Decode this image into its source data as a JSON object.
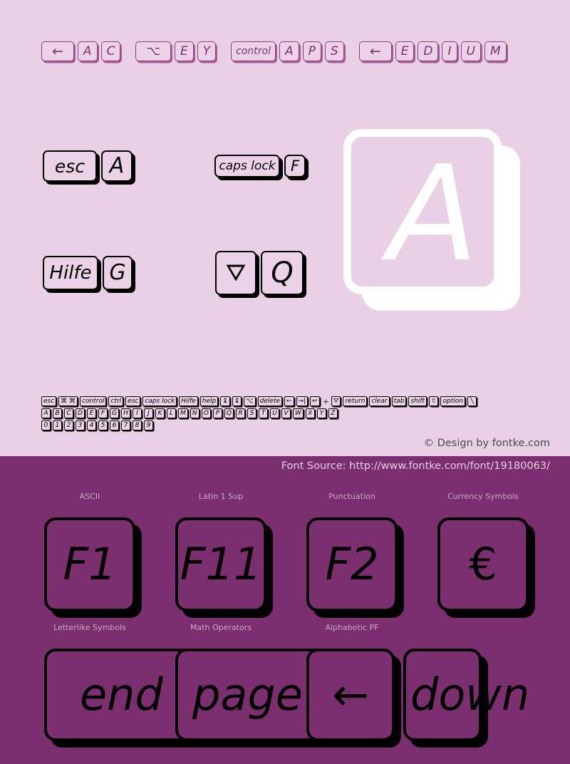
{
  "page": {
    "background_light": "#ead0e4",
    "background_dark": "#7b2f6e",
    "accent_outline": "#000000",
    "title_key_color": "#7d2f70"
  },
  "title_row": {
    "groups": [
      {
        "keys": [
          {
            "label": "←",
            "style": "arrow"
          },
          {
            "label": "A",
            "style": "letter"
          },
          {
            "label": "C",
            "style": "letter"
          }
        ]
      },
      {
        "keys": [
          {
            "label": "⌥",
            "style": "opt"
          },
          {
            "label": "E",
            "style": "letter"
          },
          {
            "label": "Y",
            "style": "letter"
          }
        ]
      },
      {
        "keys": [
          {
            "label": "control",
            "style": "word"
          },
          {
            "label": "A",
            "style": "letter"
          },
          {
            "label": "P",
            "style": "letter"
          },
          {
            "label": "S",
            "style": "letter"
          }
        ]
      },
      {
        "keys": [
          {
            "label": "←",
            "style": "arrow"
          },
          {
            "label": "E",
            "style": "letter"
          },
          {
            "label": "D",
            "style": "letter"
          },
          {
            "label": "I",
            "style": "letter"
          },
          {
            "label": "U",
            "style": "letter"
          },
          {
            "label": "M",
            "style": "letter"
          }
        ]
      }
    ]
  },
  "samples": {
    "esc": "esc",
    "a_small": "A",
    "caps_lock": "caps lock",
    "f_small": "F",
    "hilfe": "Hilfe",
    "g_small": "G",
    "notdef": "⛛",
    "q_small": "Q",
    "big_letter": "A"
  },
  "charmap": {
    "row1": [
      "esc",
      "⌘ ⌘",
      "control",
      "ctrl",
      "esc",
      "caps lock",
      "Hilfe",
      "help",
      "↨",
      "↨",
      "⌥",
      "delete",
      "←",
      "→|",
      "↩"
    ],
    "separator": "+",
    "row1b": [
      "⛛",
      "return",
      "clear",
      "tab",
      "shift",
      "⇧",
      "option",
      "╲"
    ],
    "row2": [
      "A",
      "B",
      "C",
      "D",
      "E",
      "F",
      "G",
      "H",
      "I",
      "J",
      "K",
      "L",
      "M",
      "N",
      "O",
      "P",
      "Q",
      "R",
      "S",
      "T",
      "U",
      "V",
      "W",
      "X",
      "Y",
      "Z"
    ],
    "row3": [
      "0",
      "1",
      "2",
      "3",
      "4",
      "5",
      "6",
      "7",
      "8",
      "9"
    ]
  },
  "footer": {
    "copyright": "© Design by fontke.com",
    "source": "Font Source: http://www.fontke.com/font/19180063/"
  },
  "categories": {
    "row1": [
      "ASCII",
      "Latin 1 Sup",
      "Punctuation",
      "Currency Symbols"
    ],
    "row2": [
      "Letterlike Symbols",
      "Math Operators",
      "Alphabetic PF"
    ]
  },
  "big_keys": {
    "row1": [
      "F1",
      "F11",
      "F2",
      "€"
    ],
    "row2": [
      "end",
      "page",
      "←",
      "down"
    ]
  }
}
